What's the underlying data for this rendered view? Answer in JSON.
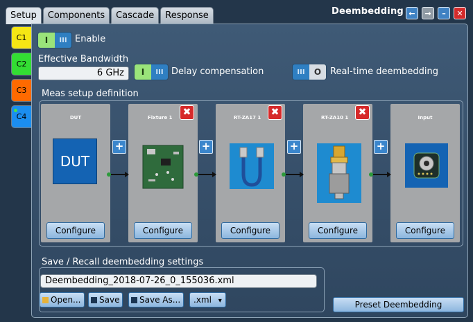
{
  "window": {
    "title": "Deembedding",
    "tabs": [
      "Setup",
      "Components",
      "Cascade",
      "Response"
    ],
    "active_tab": "Setup",
    "controls": {
      "left_arrow": "←",
      "right_arrow": "→",
      "minimize": "–",
      "close": "✕"
    }
  },
  "channels": [
    {
      "label": "C1",
      "color": "#f5e614"
    },
    {
      "label": "C2",
      "color": "#33dd33"
    },
    {
      "label": "C3",
      "color": "#ff6a00"
    },
    {
      "label": "C4",
      "color": "#1b8ef0",
      "active": true
    }
  ],
  "enable": {
    "label": "Enable",
    "state": "on",
    "on_glyph": "I",
    "knob_glyph": "III"
  },
  "bandwidth": {
    "label": "Effective Bandwidth",
    "value": "6 GHz"
  },
  "delay_compensation": {
    "label": "Delay compensation",
    "state": "on",
    "on_glyph": "I",
    "knob_glyph": "III"
  },
  "realtime": {
    "label": "Real-time deembedding",
    "state": "off",
    "knob_glyph": "III",
    "off_glyph": "O"
  },
  "meas_setup": {
    "label": "Meas setup definition",
    "blocks": [
      {
        "title": "DUT",
        "image": "dut-icon",
        "image_text": "DUT",
        "configure": "Configure",
        "removable": false
      },
      {
        "title": "Fixture 1",
        "image": "pcb-board-icon",
        "configure": "Configure",
        "removable": true
      },
      {
        "title": "RT-ZA17 1",
        "image": "cable-icon",
        "configure": "Configure",
        "removable": true
      },
      {
        "title": "RT-ZA10 1",
        "image": "adapter-icon",
        "configure": "Configure",
        "removable": true
      },
      {
        "title": "Input",
        "image": "input-connector-icon",
        "configure": "Configure",
        "removable": false
      }
    ],
    "remove_glyph": "✖",
    "add_glyph": "+"
  },
  "save_recall": {
    "label": "Save / Recall deembedding settings",
    "filename": "Deembedding_2018-07-26_0_155036.xml",
    "open": "Open...",
    "save": "Save",
    "save_as": "Save As...",
    "format": ".xml",
    "format_arrow": "▾"
  },
  "preset": "Preset Deembedding",
  "colors": {
    "accent_blue": "#2f7fc2",
    "toggle_on": "#9ae37a",
    "remove_red": "#d62a2a",
    "block_grey": "#a5a7a9"
  }
}
